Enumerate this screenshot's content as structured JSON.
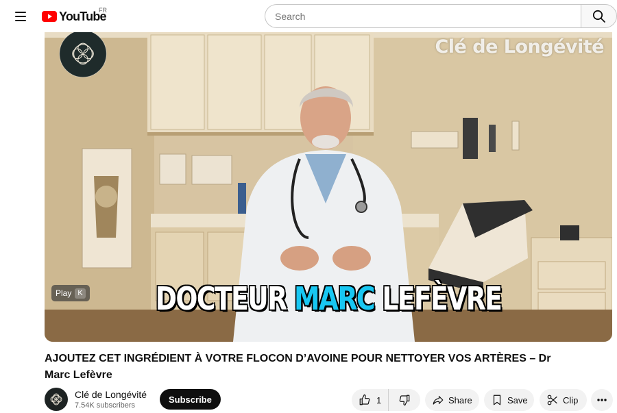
{
  "header": {
    "logo_text": "YouTube",
    "country_code": "FR",
    "search_placeholder": "Search",
    "brand_color": "#ff0000"
  },
  "player": {
    "watermark": "Clé de Longévité",
    "caption_part1": "DOCTEUR ",
    "caption_highlight": "MARC",
    "caption_part2": " LEFÈVRE",
    "caption_highlight_color": "#18c7f2",
    "play_label": "Play",
    "play_key": "K"
  },
  "video": {
    "title": "AJOUTEZ CET INGRÉDIENT À VOTRE FLOCON D’AVOINE POUR NETTOYER VOS ARTÈRES – Dr Marc Lefèvre"
  },
  "channel": {
    "name": "Clé de Longévité",
    "subscribers": "7.54K subscribers",
    "subscribe_label": "Subscribe"
  },
  "actions": {
    "like_count": "1",
    "share_label": "Share",
    "save_label": "Save",
    "clip_label": "Clip"
  },
  "icons": [
    "menu-icon",
    "youtube-logo-icon",
    "search-icon",
    "like-icon",
    "dislike-icon",
    "share-icon",
    "save-icon",
    "clip-icon",
    "more-icon"
  ]
}
